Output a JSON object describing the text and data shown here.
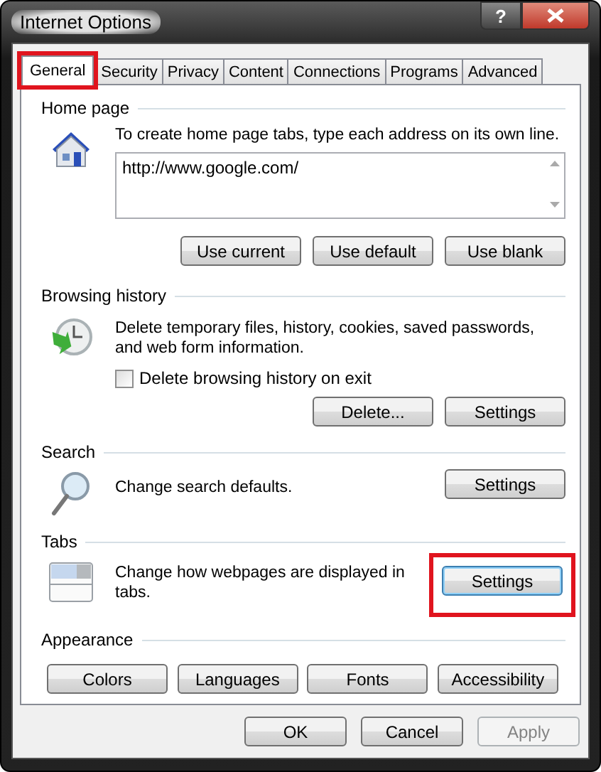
{
  "window": {
    "title": "Internet Options",
    "help_label": "?"
  },
  "tabs": [
    {
      "label": "General",
      "selected": true,
      "highlighted": true
    },
    {
      "label": "Security",
      "selected": false,
      "highlighted": false
    },
    {
      "label": "Privacy",
      "selected": false,
      "highlighted": false
    },
    {
      "label": "Content",
      "selected": false,
      "highlighted": false
    },
    {
      "label": "Connections",
      "selected": false,
      "highlighted": false
    },
    {
      "label": "Programs",
      "selected": false,
      "highlighted": false
    },
    {
      "label": "Advanced",
      "selected": false,
      "highlighted": false
    }
  ],
  "home_page": {
    "title": "Home page",
    "description": "To create home page tabs, type each address on its own line.",
    "addresses": "http://www.google.com/",
    "buttons": [
      {
        "label": "Use current"
      },
      {
        "label": "Use default"
      },
      {
        "label": "Use blank"
      }
    ]
  },
  "browsing_history": {
    "title": "Browsing history",
    "description": "Delete temporary files, history, cookies, saved passwords, and web form information.",
    "checkbox": {
      "label": "Delete browsing history on exit",
      "checked": false
    },
    "buttons": [
      {
        "label": "Delete..."
      },
      {
        "label": "Settings"
      }
    ]
  },
  "search": {
    "title": "Search",
    "description": "Change search defaults.",
    "buttons": [
      {
        "label": "Settings"
      }
    ]
  },
  "tabs_section": {
    "title": "Tabs",
    "description": "Change how webpages are displayed in tabs.",
    "buttons": [
      {
        "label": "Settings",
        "highlighted": true,
        "focused": true
      }
    ]
  },
  "appearance": {
    "title": "Appearance",
    "buttons": [
      {
        "label": "Colors"
      },
      {
        "label": "Languages"
      },
      {
        "label": "Fonts"
      },
      {
        "label": "Accessibility"
      }
    ]
  },
  "dialog_buttons": [
    {
      "label": "OK",
      "disabled": false
    },
    {
      "label": "Cancel",
      "disabled": false
    },
    {
      "label": "Apply",
      "disabled": true
    }
  ]
}
